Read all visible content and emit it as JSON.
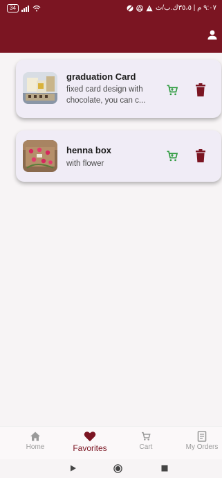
{
  "status_bar": {
    "battery": "34",
    "time": "٩:٠٧ م | ٣٥،٥ك.ب/ث",
    "colors": {
      "bar": "#7b1522"
    }
  },
  "items": [
    {
      "title": "graduation Card",
      "description_lines": [
        "fixed card design with",
        "chocolate, you can c..."
      ]
    },
    {
      "title": "henna box",
      "description_lines": [
        "with flower"
      ]
    }
  ],
  "bottom_nav": [
    {
      "label": "Home",
      "icon": "home-icon",
      "active": false
    },
    {
      "label": "Favorites",
      "icon": "heart-icon",
      "active": true
    },
    {
      "label": "Cart",
      "icon": "cart-icon",
      "active": false
    },
    {
      "label": "My Orders",
      "icon": "orders-icon",
      "active": false
    }
  ],
  "colors": {
    "accent": "#7b1522",
    "cart": "#2e9b3f",
    "delete": "#7b1522"
  }
}
